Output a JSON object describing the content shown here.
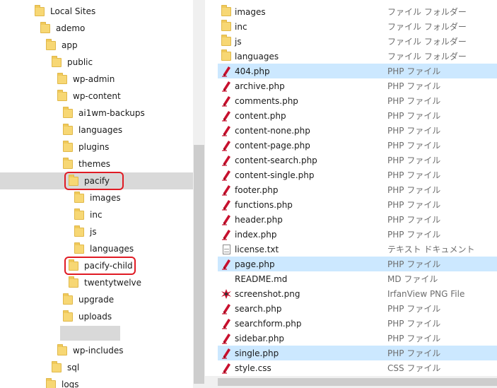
{
  "tree": {
    "items": [
      {
        "label": "Local Sites"
      },
      {
        "label": "ademo"
      },
      {
        "label": "app"
      },
      {
        "label": "public"
      },
      {
        "label": "wp-admin"
      },
      {
        "label": "wp-content"
      },
      {
        "label": "ai1wm-backups"
      },
      {
        "label": "languages"
      },
      {
        "label": "plugins"
      },
      {
        "label": "themes"
      },
      {
        "label": "pacify"
      },
      {
        "label": "images"
      },
      {
        "label": "inc"
      },
      {
        "label": "js"
      },
      {
        "label": "languages"
      },
      {
        "label": "pacify-child"
      },
      {
        "label": "twentytwelve"
      },
      {
        "label": "upgrade"
      },
      {
        "label": "uploads"
      },
      {
        "label": "wp-includes"
      },
      {
        "label": "sql"
      },
      {
        "label": "logs"
      }
    ]
  },
  "files": {
    "items": [
      {
        "name": "images",
        "type": "ファイル フォルダー",
        "icon": "folder-icon"
      },
      {
        "name": "inc",
        "type": "ファイル フォルダー",
        "icon": "folder-icon"
      },
      {
        "name": "js",
        "type": "ファイル フォルダー",
        "icon": "folder-icon"
      },
      {
        "name": "languages",
        "type": "ファイル フォルダー",
        "icon": "folder-icon"
      },
      {
        "name": "404.php",
        "type": "PHP ファイル",
        "icon": "php-file-icon"
      },
      {
        "name": "archive.php",
        "type": "PHP ファイル",
        "icon": "php-file-icon"
      },
      {
        "name": "comments.php",
        "type": "PHP ファイル",
        "icon": "php-file-icon"
      },
      {
        "name": "content.php",
        "type": "PHP ファイル",
        "icon": "php-file-icon"
      },
      {
        "name": "content-none.php",
        "type": "PHP ファイル",
        "icon": "php-file-icon"
      },
      {
        "name": "content-page.php",
        "type": "PHP ファイル",
        "icon": "php-file-icon"
      },
      {
        "name": "content-search.php",
        "type": "PHP ファイル",
        "icon": "php-file-icon"
      },
      {
        "name": "content-single.php",
        "type": "PHP ファイル",
        "icon": "php-file-icon"
      },
      {
        "name": "footer.php",
        "type": "PHP ファイル",
        "icon": "php-file-icon"
      },
      {
        "name": "functions.php",
        "type": "PHP ファイル",
        "icon": "php-file-icon"
      },
      {
        "name": "header.php",
        "type": "PHP ファイル",
        "icon": "php-file-icon"
      },
      {
        "name": "index.php",
        "type": "PHP ファイル",
        "icon": "php-file-icon"
      },
      {
        "name": "license.txt",
        "type": "テキスト ドキュメント",
        "icon": "text-document-icon"
      },
      {
        "name": "page.php",
        "type": "PHP ファイル",
        "icon": "php-file-icon"
      },
      {
        "name": "README.md",
        "type": "MD ファイル",
        "icon": "md-file-icon"
      },
      {
        "name": "screenshot.png",
        "type": "IrfanView PNG File",
        "icon": "irfanview-png-icon"
      },
      {
        "name": "search.php",
        "type": "PHP ファイル",
        "icon": "php-file-icon"
      },
      {
        "name": "searchform.php",
        "type": "PHP ファイル",
        "icon": "php-file-icon"
      },
      {
        "name": "sidebar.php",
        "type": "PHP ファイル",
        "icon": "php-file-icon"
      },
      {
        "name": "single.php",
        "type": "PHP ファイル",
        "icon": "php-file-icon"
      },
      {
        "name": "style.css",
        "type": "CSS ファイル",
        "icon": "css-file-icon"
      }
    ]
  },
  "colors": {
    "selection_blue": "#cce8ff",
    "selection_gray": "#d9d9d9",
    "highlight_red": "#e01b24",
    "folder_yellow": "#f7d774"
  }
}
